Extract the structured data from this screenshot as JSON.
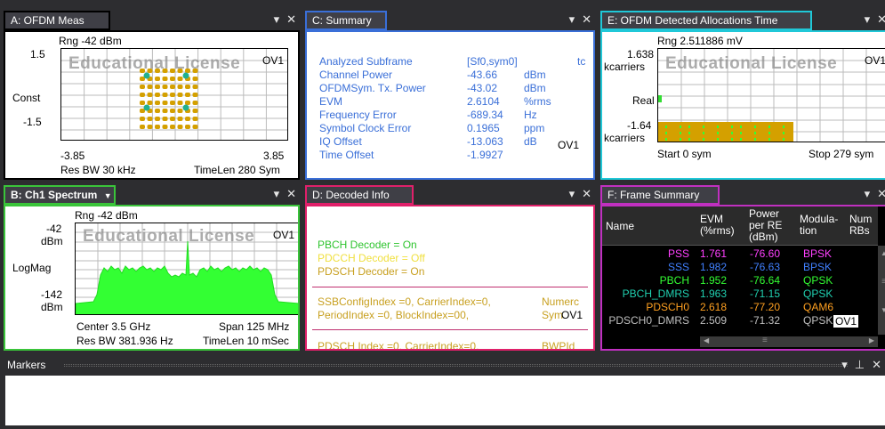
{
  "colors": {
    "paneA": "#000000",
    "paneB": "#3ac43a",
    "paneC": "#3a6fd8",
    "paneD": "#e0206a",
    "paneE": "#20c8d8",
    "paneF": "#c030c0",
    "dot": "#d4a000",
    "teal": "#20b090",
    "green": "#33ff33"
  },
  "controls": {
    "dropdown": "▾",
    "close": "✕",
    "pin": "⊥"
  },
  "paneA": {
    "tab": "A: OFDM Meas",
    "rng": "Rng -42 dBm",
    "ytop": "1.5",
    "ymid": "Const",
    "ybot": "-1.5",
    "watermark": "Educational License",
    "ov": "OV1",
    "xleft": "-3.85",
    "xright": "3.85",
    "resbw": "Res BW 30 kHz",
    "timelen": "TimeLen 280  Sym"
  },
  "paneB": {
    "tab": "B: Ch1 Spectrum",
    "tab_caret": "▼",
    "rng": "Rng -42 dBm",
    "ytop1": "-42",
    "ytop2": "dBm",
    "ymid": "LogMag",
    "ybot1": "-142",
    "ybot2": "dBm",
    "watermark": "Educational License",
    "ov": "OV1",
    "center": "Center 3.5 GHz",
    "span": "Span 125 MHz",
    "resbw": "Res BW 381.936  Hz",
    "timelen": "TimeLen 10 mSec"
  },
  "paneC": {
    "tab": "C: Summary",
    "rows": [
      {
        "label": "Analyzed   Subframe",
        "value": "[Sf0,sym0]",
        "unit": "tc"
      },
      {
        "label": "Channel  Power",
        "value": "-43.66",
        "unit": "dBm"
      },
      {
        "label": "OFDMSym.  Tx.  Power",
        "value": "-43.02",
        "unit": "dBm"
      },
      {
        "label": "EVM",
        "value": "2.6104",
        "unit": "%rms"
      },
      {
        "label": "Frequency   Error",
        "value": "-689.34",
        "unit": "Hz"
      },
      {
        "label": "Symbol  Clock   Error",
        "value": "0.1965",
        "unit": "ppm"
      },
      {
        "label": "IQ   Offset",
        "value": "-13.063",
        "unit": "dB"
      },
      {
        "label": "Time   Offset",
        "value": "-1.9927",
        "unit": ""
      }
    ],
    "ov": "OV1"
  },
  "paneD": {
    "tab": "D: Decoded Info",
    "pbch": "PBCH Decoder   =  On",
    "pdcch": "PDCCH Decoder =  Off",
    "pdsch": "PDSCH Decoder =  On",
    "ssb": "SSBConfigIndex =0,   CarrierIndex=0,",
    "ssb_tail": "Numerc",
    "period": "PeriodIndex       =0,   BlockIndex=00,",
    "period_tail": "Sym",
    "pdsch2": "PDSCH Index      =0,   CarrierIndex=0,",
    "pdsch2_tail": "BWPId",
    "ov": "OV1"
  },
  "paneE": {
    "tab": "E: OFDM Detected Allocations Time",
    "rng": "Rng 2.511886 mV",
    "ytop1": "1.638",
    "ytop2": "kcarriers",
    "ymid": "Real",
    "ybot1": "-1.64",
    "ybot2": "kcarriers",
    "watermark": "Educational License",
    "ov": "OV1",
    "start": "Start 0  sym",
    "stop": "Stop 279  sym"
  },
  "paneF": {
    "tab": "F: Frame Summary",
    "headers": [
      "Name",
      "EVM (%rms)",
      "Power per RE (dBm)",
      "Modula- tion",
      "Num RBs"
    ],
    "rows": [
      {
        "name": "PSS",
        "evm": "1.761",
        "power": "-76.60",
        "mod": "BPSK",
        "color": "#ff40ff"
      },
      {
        "name": "SSS",
        "evm": "1.982",
        "power": "-76.63",
        "mod": "BPSK",
        "color": "#4080ff"
      },
      {
        "name": "PBCH",
        "evm": "1.952",
        "power": "-76.64",
        "mod": "QPSK",
        "color": "#33ff33"
      },
      {
        "name": "PBCH_DMRS",
        "evm": "1.963",
        "power": "-71.15",
        "mod": "QPSK",
        "color": "#20d0b0"
      },
      {
        "name": "PDSCH0",
        "evm": "2.618",
        "power": "-77.20",
        "mod": "QAM6",
        "color": "#ffa020"
      },
      {
        "name": "PDSCH0_DMRS",
        "evm": "2.509",
        "power": "-71.32",
        "mod": "QPSK",
        "color": "#c0c0c0"
      }
    ],
    "ov": "OV1",
    "scroll_up": "▲",
    "scroll_down": "▼",
    "scroll_left": "◀",
    "scroll_right": "▶",
    "scroll_grip": "≡"
  },
  "markers": {
    "title": "Markers"
  }
}
